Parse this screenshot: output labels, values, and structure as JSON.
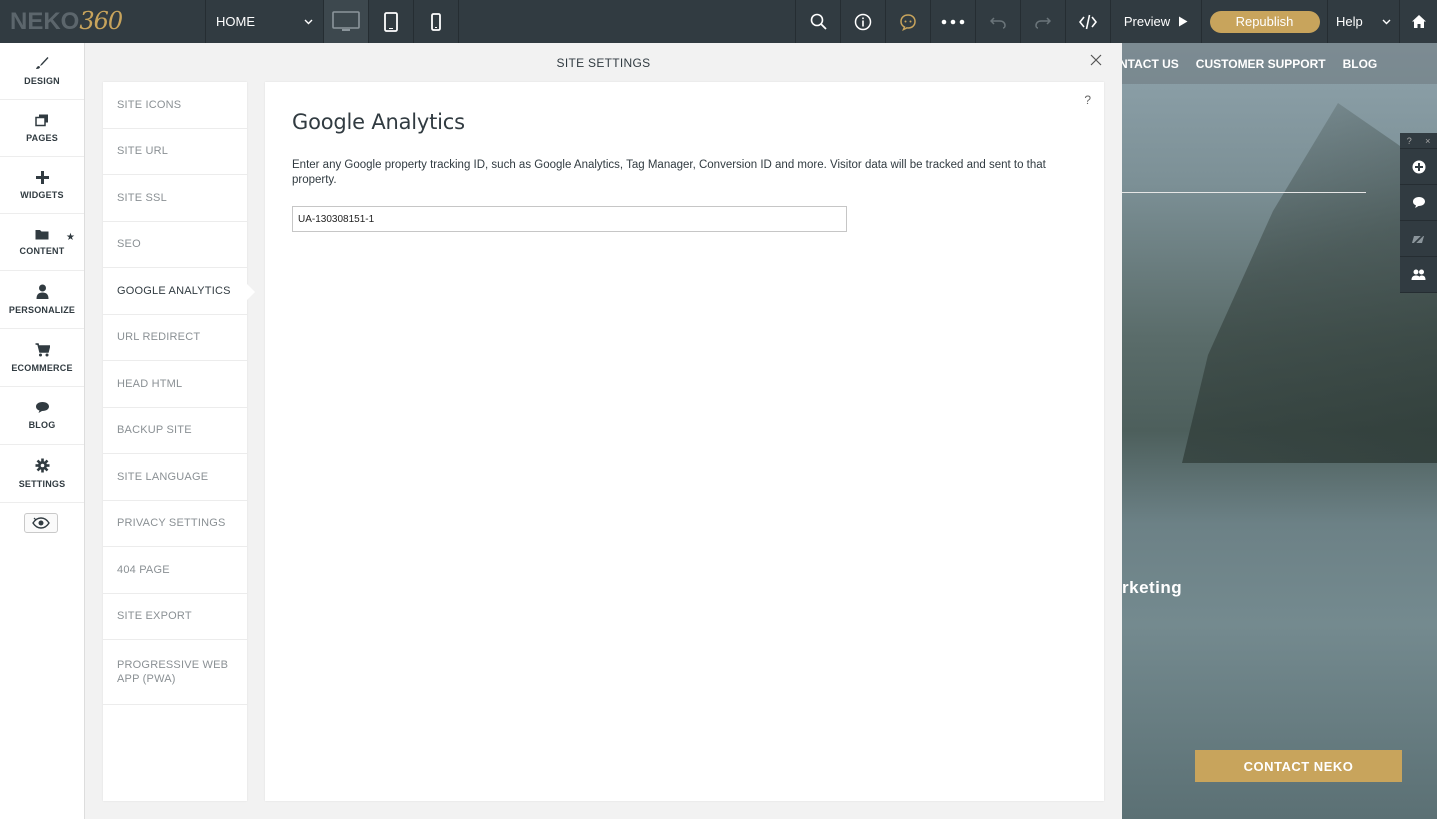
{
  "topbar": {
    "logo": {
      "part1": "NEKO",
      "part2": "360"
    },
    "page_select": "HOME",
    "preview_label": "Preview",
    "republish_label": "Republish",
    "help_label": "Help",
    "icons": [
      "desktop-icon",
      "tablet-icon",
      "mobile-icon",
      "search-icon",
      "info-icon",
      "chat-icon",
      "more-icon",
      "undo-icon",
      "redo-icon",
      "code-icon",
      "home-icon"
    ]
  },
  "leftnav": {
    "items": [
      {
        "label": "DESIGN",
        "icon": "brush-icon"
      },
      {
        "label": "PAGES",
        "icon": "pages-icon"
      },
      {
        "label": "WIDGETS",
        "icon": "plus-icon"
      },
      {
        "label": "CONTENT",
        "icon": "folder-icon"
      },
      {
        "label": "PERSONALIZE",
        "icon": "person-icon"
      },
      {
        "label": "ECOMMERCE",
        "icon": "cart-icon"
      },
      {
        "label": "BLOG",
        "icon": "comment-icon"
      },
      {
        "label": "SETTINGS",
        "icon": "gear-icon"
      }
    ],
    "active": "SETTINGS"
  },
  "modal": {
    "title": "SITE SETTINGS",
    "help": "?",
    "settings_items": [
      "SITE ICONS",
      "SITE URL",
      "SITE SSL",
      "SEO",
      "GOOGLE ANALYTICS",
      "URL REDIRECT",
      "HEAD HTML",
      "BACKUP SITE",
      "SITE LANGUAGE",
      "PRIVACY SETTINGS",
      "404 PAGE",
      "SITE EXPORT",
      "PROGRESSIVE WEB APP (PWA)"
    ],
    "active_item": "GOOGLE ANALYTICS",
    "panel": {
      "title": "Google Analytics",
      "description": "Enter any Google property tracking ID, such as Google Analytics, Tag Manager, Conversion ID and more. Visitor data will be tracked and sent to that property.",
      "tracking_id": "UA-130308151-1"
    }
  },
  "site_preview": {
    "nav": [
      "NTACT US",
      "CUSTOMER SUPPORT",
      "BLOG"
    ],
    "text_fragment": "rketing",
    "contact_button": "CONTACT NEKO",
    "tools_top": [
      "?",
      "×"
    ]
  },
  "colors": {
    "topbar": "#313b41",
    "accent": "#c8a45c"
  }
}
